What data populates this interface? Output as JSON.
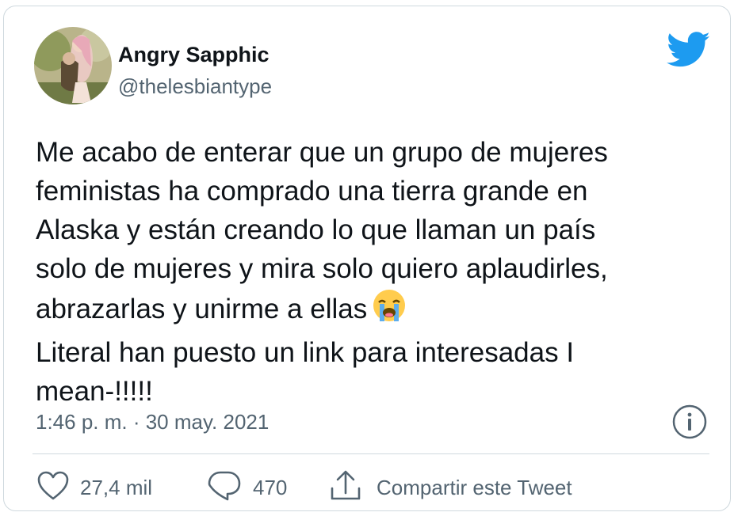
{
  "author": {
    "name": "Angry Sapphic",
    "handle": "@thelesbiantype",
    "avatar": "avatar-illustration-two-women-embracing"
  },
  "brand_icon": "twitter-bird-icon",
  "colors": {
    "brand_blue": "#1d9bf0",
    "text_primary": "#0f1419",
    "text_secondary": "#536471",
    "border": "#cfd9de"
  },
  "tweet": {
    "lines": [
      "Me acabo de enterar que un grupo de mujeres",
      "feministas ha comprado una tierra grande en",
      "Alaska y están creando lo que llaman un país",
      "solo de mujeres y mira solo quiero aplaudirles,",
      "abrazarlas y unirme a ellas",
      "Literal han puesto un link para interesadas I",
      "mean-!!!!!"
    ],
    "emoji": "loudly-crying-face-emoji"
  },
  "timestamp": "1:46 p. m. · 30 may. 2021",
  "info_icon": "info-icon",
  "actions": {
    "like": {
      "icon": "heart-icon",
      "count": "27,4 mil"
    },
    "reply": {
      "icon": "speech-bubble-icon",
      "count": "470"
    },
    "share": {
      "icon": "share-icon",
      "label": "Compartir este Tweet"
    }
  }
}
